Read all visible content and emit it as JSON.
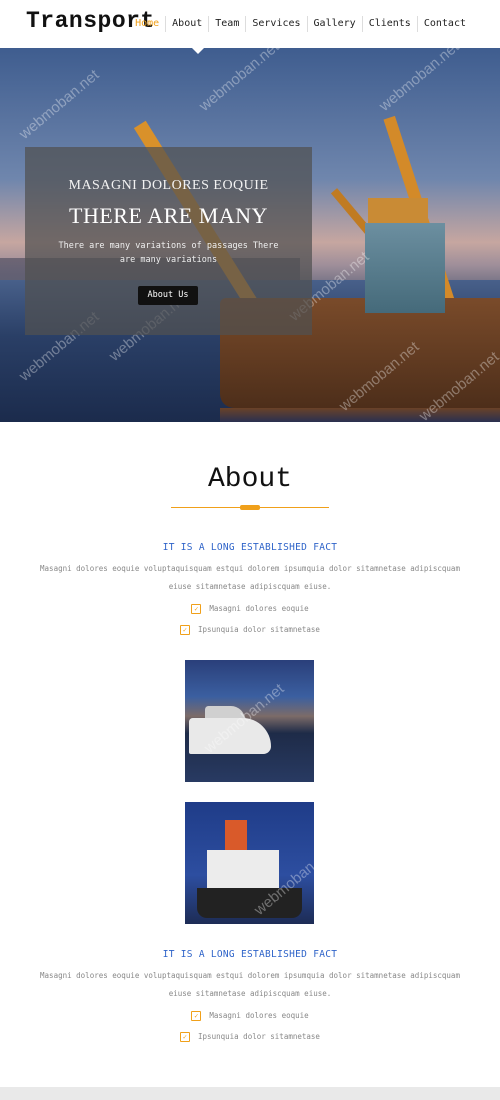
{
  "header": {
    "logo": "Transport",
    "nav": [
      "Home",
      "About",
      "Team",
      "Services",
      "Gallery",
      "Clients",
      "Contact"
    ]
  },
  "hero": {
    "subtitle": "MASAGNI DOLORES EOQUIE",
    "title": "THERE ARE MANY",
    "text": "There are many variations of passages There are many variations",
    "button": "About Us"
  },
  "about": {
    "title": "About",
    "blocks": [
      {
        "heading": "IT IS A LONG ESTABLISHED FACT",
        "paragraph": "Masagni dolores eoquie voluptaquisquam estqui dolorem ipsumquia dolor sitamnetase adipiscquam eiuse sitamnetase adipiscquam eiuse.",
        "checks": [
          "Masagni dolores eoquie",
          "Ipsunquia dolor sitamnetase"
        ]
      },
      {
        "heading": "IT IS A LONG ESTABLISHED FACT",
        "paragraph": "Masagni dolores eoquie voluptaquisquam estqui dolorem ipsumquia dolor sitamnetase adipiscquam eiuse sitamnetase adipiscquam eiuse.",
        "checks": [
          "Masagni dolores eoquie",
          "Ipsunquia dolor sitamnetase"
        ]
      }
    ]
  },
  "watermark": "webmoban.net",
  "colors": {
    "accent": "#f0a01a",
    "link_blue": "#2f64c9"
  }
}
